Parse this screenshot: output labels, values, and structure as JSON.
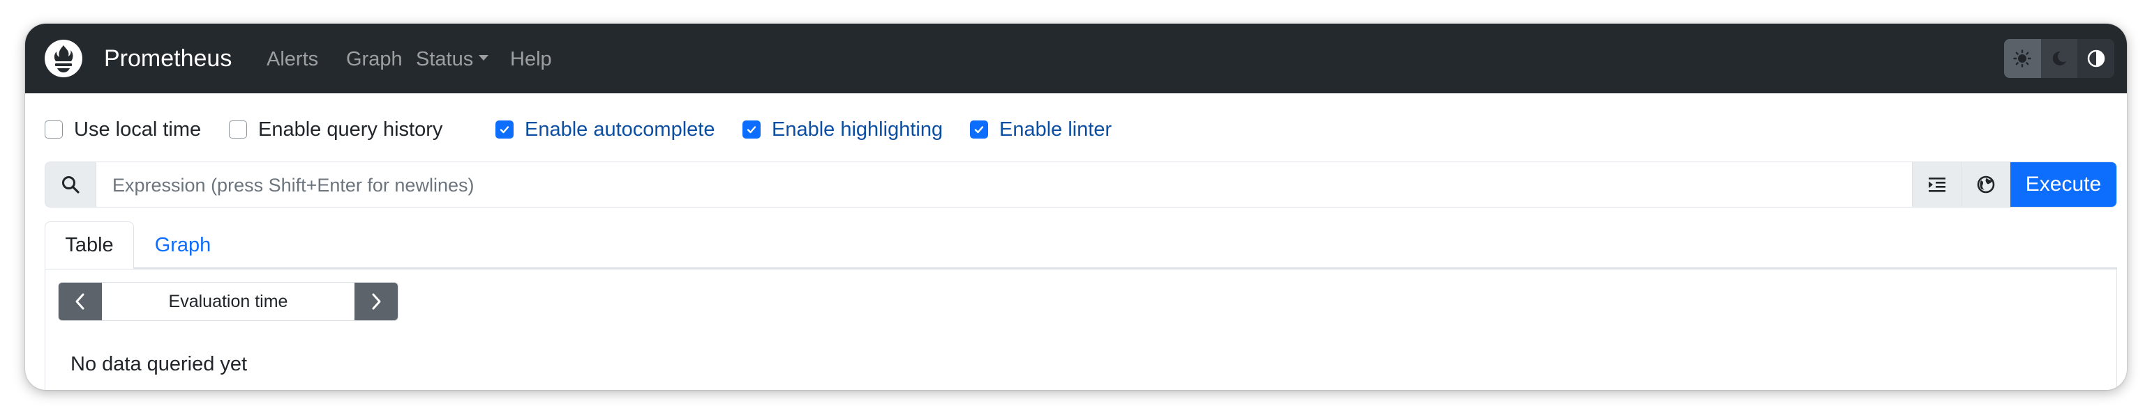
{
  "navbar": {
    "brand": "Prometheus",
    "links": [
      {
        "label": "Alerts"
      },
      {
        "label": "Graph"
      },
      {
        "label": "Status"
      },
      {
        "label": "Help"
      }
    ]
  },
  "theme_toggle": {
    "options": [
      "light",
      "dark",
      "auto"
    ]
  },
  "options": [
    {
      "label": "Use local time",
      "checked": false
    },
    {
      "label": "Enable query history",
      "checked": false
    },
    {
      "label": "Enable autocomplete",
      "checked": true
    },
    {
      "label": "Enable highlighting",
      "checked": true
    },
    {
      "label": "Enable linter",
      "checked": true
    }
  ],
  "query": {
    "placeholder": "Expression (press Shift+Enter for newlines)",
    "value": "",
    "execute_label": "Execute"
  },
  "tabs": [
    {
      "label": "Table",
      "active": true
    },
    {
      "label": "Graph",
      "active": false
    }
  ],
  "table_panel": {
    "evaluation_time_label": "Evaluation time",
    "empty_message": "No data queried yet"
  },
  "colors": {
    "navbar_bg": "#24292e",
    "primary": "#0d6efd",
    "checked_label": "#0b4ea2"
  }
}
